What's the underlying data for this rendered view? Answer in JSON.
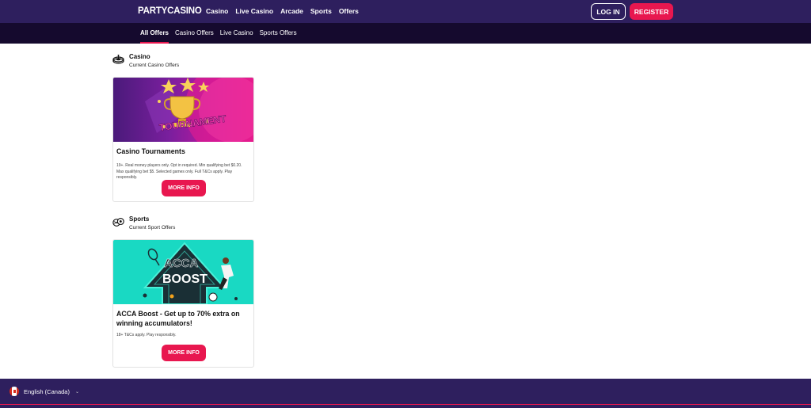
{
  "header": {
    "logo": "PARTYCASINO",
    "nav": [
      "Casino",
      "Live Casino",
      "Arcade",
      "Sports",
      "Offers"
    ],
    "login_label": "LOG IN",
    "register_label": "REGISTER"
  },
  "subnav": {
    "items": [
      "All Offers",
      "Casino Offers",
      "Live Casino",
      "Sports Offers"
    ],
    "active_index": 0
  },
  "sections": [
    {
      "title": "Casino",
      "subtitle": "Current Casino Offers",
      "icon": "roulette-icon",
      "card": {
        "banner_text": "TOURNAMENT",
        "title": "Casino Tournaments",
        "terms": "19+. Real money players only. Opt in required. Min qualifying bet $0.20. Max qualifying bet $5. Selected games only. Full T&Cs apply. Play responsibly.",
        "button": "MORE INFO"
      }
    },
    {
      "title": "Sports",
      "subtitle": "Current Sport Offers",
      "icon": "sports-balls-icon",
      "card": {
        "banner_text_1": "ACCA",
        "banner_text_2": "BOOST",
        "title": "ACCA Boost - Get up to 70% extra on winning accumulators!",
        "terms": "18+ T&Cs apply. Play responsibly.",
        "button": "MORE INFO"
      }
    }
  ],
  "footer": {
    "language": "English (Canada)",
    "flag_icon": "canada-flag-icon"
  },
  "colors": {
    "header_bg": "#2e1f5e",
    "subnav_bg": "#150a2e",
    "accent": "#e8174f"
  }
}
